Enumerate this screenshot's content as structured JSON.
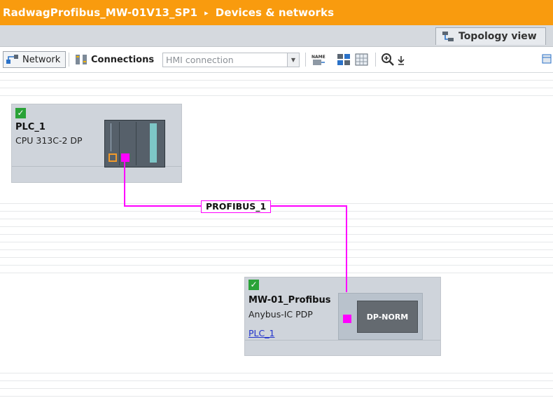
{
  "breadcrumb": {
    "project": "RadwagProfibus_MW-01V13_SP1",
    "separator": "▸",
    "section": "Devices & networks"
  },
  "tabs": {
    "topology_view": "Topology view"
  },
  "toolbar": {
    "network_label": "Network",
    "connections_label": "Connections",
    "connection_type_value": "HMI connection",
    "name_icon_text": "NAME"
  },
  "devices": [
    {
      "name": "PLC_1",
      "type": "CPU 313C-2 DP",
      "status": "ok"
    },
    {
      "name": "MW-01_Profibus",
      "type": "Anybus-IC PDP",
      "assigned_to": "PLC_1",
      "status": "ok",
      "module_label": "DP-NORM"
    }
  ],
  "network": {
    "bus_name": "PROFIBUS_1",
    "bus_color": "#ff00ff"
  },
  "colors": {
    "title_bar": "#f99b0e",
    "device_bg": "#cfd4db",
    "status_ok": "#2aa237"
  }
}
